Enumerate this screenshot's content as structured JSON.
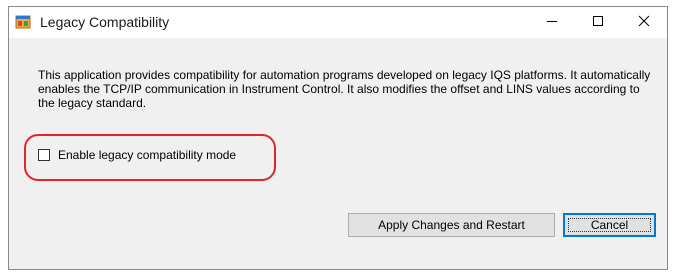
{
  "window": {
    "title": "Legacy Compatibility",
    "icon": "app-window-icon",
    "controls": [
      "minimize-icon",
      "maximize-icon",
      "close-icon"
    ]
  },
  "description": "This application provides compatibility for automation programs developed on legacy IQS platforms. It automatically enables the TCP/IP communication in Instrument Control. It also modifies the offset and LINS values according to the legacy standard.",
  "checkbox": {
    "label": "Enable legacy compatibility mode",
    "checked": false
  },
  "buttons": {
    "apply_label": "Apply Changes and Restart",
    "cancel_label": "Cancel"
  },
  "colors": {
    "highlight": "#e0262c",
    "focus": "#0078d7",
    "window_bg": "#f0f0f0"
  }
}
